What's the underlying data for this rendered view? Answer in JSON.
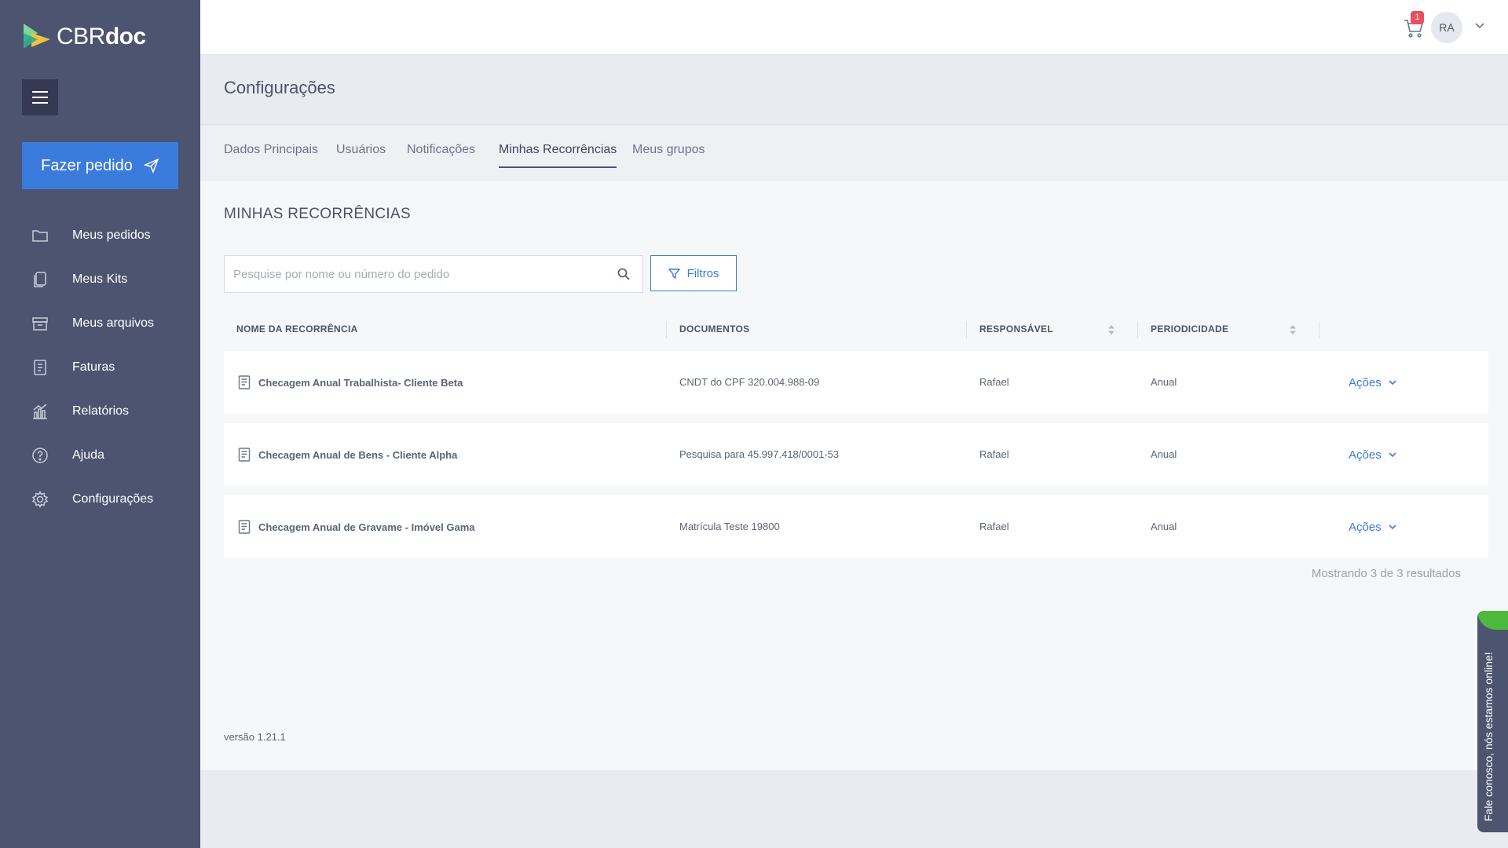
{
  "brand": {
    "name_part1": "CBR",
    "name_part2": "doc"
  },
  "sidebar": {
    "order_button": "Fazer pedido",
    "items": [
      {
        "label": "Meus pedidos",
        "icon": "folder-icon"
      },
      {
        "label": "Meus Kits",
        "icon": "kit-icon"
      },
      {
        "label": "Meus arquivos",
        "icon": "archive-icon"
      },
      {
        "label": "Faturas",
        "icon": "invoice-icon"
      },
      {
        "label": "Relatórios",
        "icon": "chart-icon"
      },
      {
        "label": "Ajuda",
        "icon": "help-icon"
      },
      {
        "label": "Configurações",
        "icon": "gear-icon"
      }
    ]
  },
  "topbar": {
    "cart_count": "1",
    "avatar_initials": "RA"
  },
  "page": {
    "title": "Configurações"
  },
  "tabs": [
    {
      "label": "Dados Principais"
    },
    {
      "label": "Usuários"
    },
    {
      "label": "Notificações"
    },
    {
      "label": "Minhas Recorrências",
      "active": true
    },
    {
      "label": "Meus grupos"
    }
  ],
  "section": {
    "title": "MINHAS RECORRÊNCIAS",
    "search_placeholder": "Pesquise por nome ou número do pedido",
    "filter_label": "Filtros"
  },
  "table": {
    "headers": [
      "NOME DA RECORRÊNCIA",
      "DOCUMENTOS",
      "RESPONSÁVEL",
      "PERIODICIDADE"
    ],
    "rows": [
      {
        "name": "Checagem Anual Trabalhista- Cliente Beta",
        "document": "CNDT do CPF 320.004.988-09",
        "responsible": "Rafael",
        "periodicity": "Anual",
        "actions": "Ações"
      },
      {
        "name": "Checagem Anual de Bens - Cliente Alpha",
        "document": "Pesquisa para 45.997.418/0001-53",
        "responsible": "Rafael",
        "periodicity": "Anual",
        "actions": "Ações"
      },
      {
        "name": "Checagem Anual de Gravame - Imóvel Gama",
        "document": "Matrícula Teste 19800",
        "responsible": "Rafael",
        "periodicity": "Anual",
        "actions": "Ações"
      }
    ],
    "results_text": "Mostrando 3 de 3 resultados"
  },
  "footer": {
    "version": "versão 1.21.1"
  },
  "chat": {
    "label": "Fale conosco, nós estamos online!"
  },
  "colors": {
    "sidebar": "#4d5470",
    "accent": "#3a7bdc",
    "badge": "#e8505b",
    "online": "#4cbb3c"
  }
}
